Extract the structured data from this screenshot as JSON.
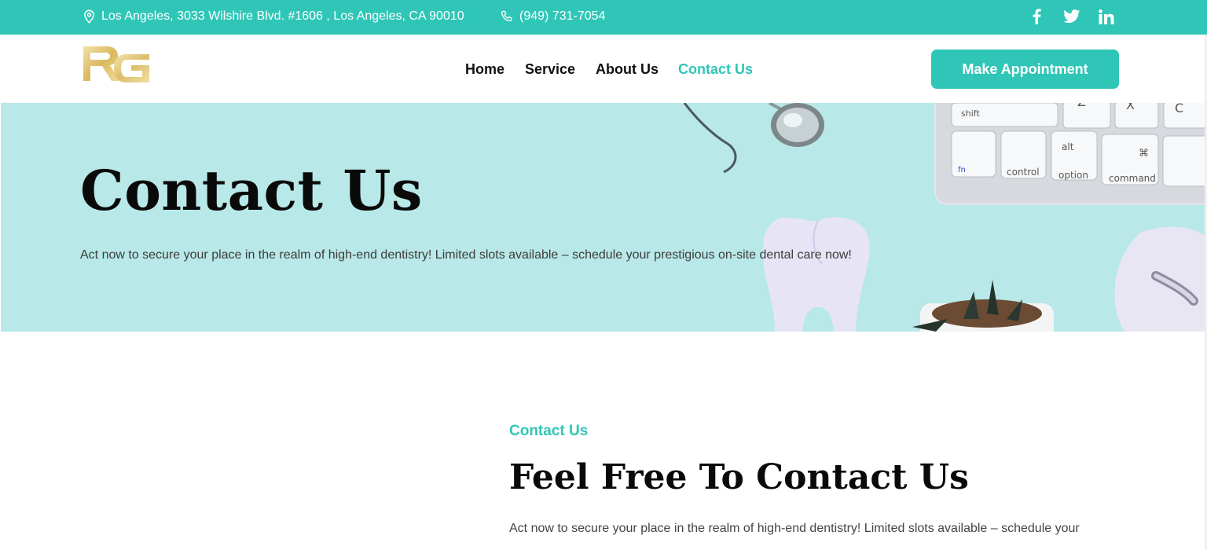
{
  "topbar": {
    "address": "Los Angeles, 3033 Wilshire Blvd. #1606 , Los Angeles, CA 90010",
    "phone": "(949) 731-7054",
    "social": [
      "facebook-icon",
      "twitter-icon",
      "linkedin-icon"
    ]
  },
  "header": {
    "logo_text": "RG",
    "nav": [
      "Home",
      "Service",
      "About Us",
      "Contact Us"
    ],
    "active_nav": "Contact Us",
    "cta": "Make Appointment"
  },
  "hero": {
    "title": "Contact Us",
    "subtitle": "Act now to secure your place in the realm of high-end dentistry! Limited slots available – schedule your prestigious on-site dental care now!",
    "keyboard_keys": [
      "shift",
      "fn",
      "control",
      "alt",
      "option",
      "⌘",
      "command",
      "Z",
      "X",
      "C"
    ]
  },
  "section": {
    "eyebrow": "Contact Us",
    "title": "Feel Free To Contact Us",
    "text": "Act now to secure your place in the realm of high-end dentistry! Limited slots available – schedule your"
  },
  "colors": {
    "accent": "#2fc6b7",
    "hero_bg": "#b8e8e7",
    "logo_gold": "#e3c97a"
  }
}
